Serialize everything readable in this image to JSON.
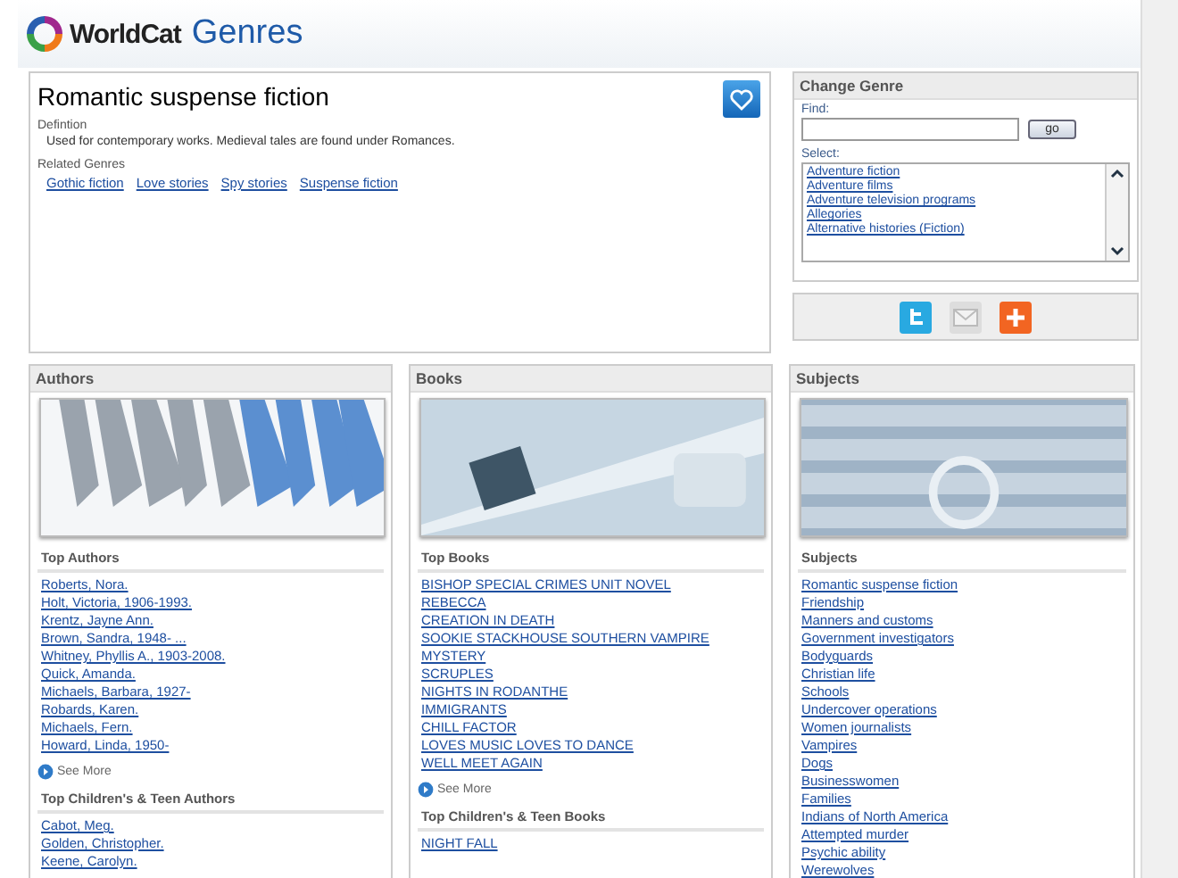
{
  "header": {
    "logo_text": "WorldCat",
    "title": "Genres"
  },
  "genre": {
    "title": "Romantic suspense fiction",
    "definition_label": "Defintion",
    "definition": "Used for contemporary works. Medieval tales are found under Romances.",
    "related_label": "Related Genres",
    "related": [
      "Gothic fiction",
      "Love stories",
      "Spy stories",
      "Suspense fiction"
    ]
  },
  "change_genre": {
    "title": "Change Genre",
    "find_label": "Find:",
    "go_button": "go",
    "select_label": "Select:",
    "options": [
      "Adventure fiction",
      "Adventure films",
      "Adventure television programs",
      "Allegories",
      "Alternative histories (Fiction)"
    ]
  },
  "panels": [
    {
      "title": "Authors",
      "kind": "pens",
      "sections": [
        {
          "heading": "Top Authors",
          "items": [
            "Roberts, Nora.",
            "Holt, Victoria, 1906-1993.",
            "Krentz, Jayne Ann.",
            "Brown, Sandra, 1948- ...",
            "Whitney, Phyllis A., 1903-2008.",
            "Quick, Amanda.",
            "Michaels, Barbara, 1927-",
            "Robards, Karen.",
            "Michaels, Fern.",
            "Howard, Linda, 1950-"
          ],
          "see_more": "See More"
        },
        {
          "heading": "Top Children's & Teen Authors",
          "items": [
            "Cabot, Meg.",
            "Golden, Christopher.",
            "Keene, Carolyn."
          ]
        }
      ]
    },
    {
      "title": "Books",
      "kind": "typewriter",
      "sections": [
        {
          "heading": "Top Books",
          "items": [
            "BISHOP SPECIAL CRIMES UNIT NOVEL",
            "REBECCA",
            "CREATION IN DEATH",
            "SOOKIE STACKHOUSE SOUTHERN VAMPIRE MYSTERY",
            "SCRUPLES",
            "NIGHTS IN RODANTHE",
            "IMMIGRANTS",
            "CHILL FACTOR",
            "LOVES MUSIC LOVES TO DANCE",
            "WELL MEET AGAIN"
          ],
          "see_more": "See More"
        },
        {
          "heading": "Top Children's & Teen Books",
          "items": [
            "NIGHT FALL"
          ]
        }
      ]
    },
    {
      "title": "Subjects",
      "kind": "letters",
      "sections": [
        {
          "heading": "Subjects",
          "items": [
            "Romantic suspense fiction",
            "Friendship",
            "Manners and customs",
            "Government investigators",
            "Bodyguards",
            "Christian life",
            "Schools",
            "Undercover operations",
            "Women journalists",
            "Vampires",
            "Dogs",
            "Businesswomen",
            "Families",
            "Indians of North America",
            "Attempted murder",
            "Psychic ability",
            "Werewolves"
          ]
        }
      ]
    }
  ]
}
